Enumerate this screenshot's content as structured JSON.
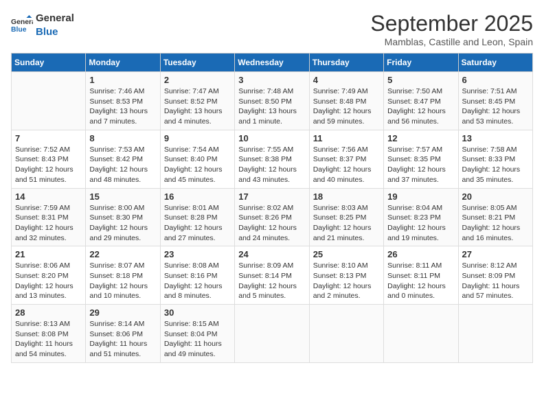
{
  "header": {
    "logo_general": "General",
    "logo_blue": "Blue",
    "month_title": "September 2025",
    "location": "Mamblas, Castille and Leon, Spain"
  },
  "days_of_week": [
    "Sunday",
    "Monday",
    "Tuesday",
    "Wednesday",
    "Thursday",
    "Friday",
    "Saturday"
  ],
  "weeks": [
    [
      {
        "day": "",
        "info": ""
      },
      {
        "day": "1",
        "info": "Sunrise: 7:46 AM\nSunset: 8:53 PM\nDaylight: 13 hours\nand 7 minutes."
      },
      {
        "day": "2",
        "info": "Sunrise: 7:47 AM\nSunset: 8:52 PM\nDaylight: 13 hours\nand 4 minutes."
      },
      {
        "day": "3",
        "info": "Sunrise: 7:48 AM\nSunset: 8:50 PM\nDaylight: 13 hours\nand 1 minute."
      },
      {
        "day": "4",
        "info": "Sunrise: 7:49 AM\nSunset: 8:48 PM\nDaylight: 12 hours\nand 59 minutes."
      },
      {
        "day": "5",
        "info": "Sunrise: 7:50 AM\nSunset: 8:47 PM\nDaylight: 12 hours\nand 56 minutes."
      },
      {
        "day": "6",
        "info": "Sunrise: 7:51 AM\nSunset: 8:45 PM\nDaylight: 12 hours\nand 53 minutes."
      }
    ],
    [
      {
        "day": "7",
        "info": "Sunrise: 7:52 AM\nSunset: 8:43 PM\nDaylight: 12 hours\nand 51 minutes."
      },
      {
        "day": "8",
        "info": "Sunrise: 7:53 AM\nSunset: 8:42 PM\nDaylight: 12 hours\nand 48 minutes."
      },
      {
        "day": "9",
        "info": "Sunrise: 7:54 AM\nSunset: 8:40 PM\nDaylight: 12 hours\nand 45 minutes."
      },
      {
        "day": "10",
        "info": "Sunrise: 7:55 AM\nSunset: 8:38 PM\nDaylight: 12 hours\nand 43 minutes."
      },
      {
        "day": "11",
        "info": "Sunrise: 7:56 AM\nSunset: 8:37 PM\nDaylight: 12 hours\nand 40 minutes."
      },
      {
        "day": "12",
        "info": "Sunrise: 7:57 AM\nSunset: 8:35 PM\nDaylight: 12 hours\nand 37 minutes."
      },
      {
        "day": "13",
        "info": "Sunrise: 7:58 AM\nSunset: 8:33 PM\nDaylight: 12 hours\nand 35 minutes."
      }
    ],
    [
      {
        "day": "14",
        "info": "Sunrise: 7:59 AM\nSunset: 8:31 PM\nDaylight: 12 hours\nand 32 minutes."
      },
      {
        "day": "15",
        "info": "Sunrise: 8:00 AM\nSunset: 8:30 PM\nDaylight: 12 hours\nand 29 minutes."
      },
      {
        "day": "16",
        "info": "Sunrise: 8:01 AM\nSunset: 8:28 PM\nDaylight: 12 hours\nand 27 minutes."
      },
      {
        "day": "17",
        "info": "Sunrise: 8:02 AM\nSunset: 8:26 PM\nDaylight: 12 hours\nand 24 minutes."
      },
      {
        "day": "18",
        "info": "Sunrise: 8:03 AM\nSunset: 8:25 PM\nDaylight: 12 hours\nand 21 minutes."
      },
      {
        "day": "19",
        "info": "Sunrise: 8:04 AM\nSunset: 8:23 PM\nDaylight: 12 hours\nand 19 minutes."
      },
      {
        "day": "20",
        "info": "Sunrise: 8:05 AM\nSunset: 8:21 PM\nDaylight: 12 hours\nand 16 minutes."
      }
    ],
    [
      {
        "day": "21",
        "info": "Sunrise: 8:06 AM\nSunset: 8:20 PM\nDaylight: 12 hours\nand 13 minutes."
      },
      {
        "day": "22",
        "info": "Sunrise: 8:07 AM\nSunset: 8:18 PM\nDaylight: 12 hours\nand 10 minutes."
      },
      {
        "day": "23",
        "info": "Sunrise: 8:08 AM\nSunset: 8:16 PM\nDaylight: 12 hours\nand 8 minutes."
      },
      {
        "day": "24",
        "info": "Sunrise: 8:09 AM\nSunset: 8:14 PM\nDaylight: 12 hours\nand 5 minutes."
      },
      {
        "day": "25",
        "info": "Sunrise: 8:10 AM\nSunset: 8:13 PM\nDaylight: 12 hours\nand 2 minutes."
      },
      {
        "day": "26",
        "info": "Sunrise: 8:11 AM\nSunset: 8:11 PM\nDaylight: 12 hours\nand 0 minutes."
      },
      {
        "day": "27",
        "info": "Sunrise: 8:12 AM\nSunset: 8:09 PM\nDaylight: 11 hours\nand 57 minutes."
      }
    ],
    [
      {
        "day": "28",
        "info": "Sunrise: 8:13 AM\nSunset: 8:08 PM\nDaylight: 11 hours\nand 54 minutes."
      },
      {
        "day": "29",
        "info": "Sunrise: 8:14 AM\nSunset: 8:06 PM\nDaylight: 11 hours\nand 51 minutes."
      },
      {
        "day": "30",
        "info": "Sunrise: 8:15 AM\nSunset: 8:04 PM\nDaylight: 11 hours\nand 49 minutes."
      },
      {
        "day": "",
        "info": ""
      },
      {
        "day": "",
        "info": ""
      },
      {
        "day": "",
        "info": ""
      },
      {
        "day": "",
        "info": ""
      }
    ]
  ]
}
